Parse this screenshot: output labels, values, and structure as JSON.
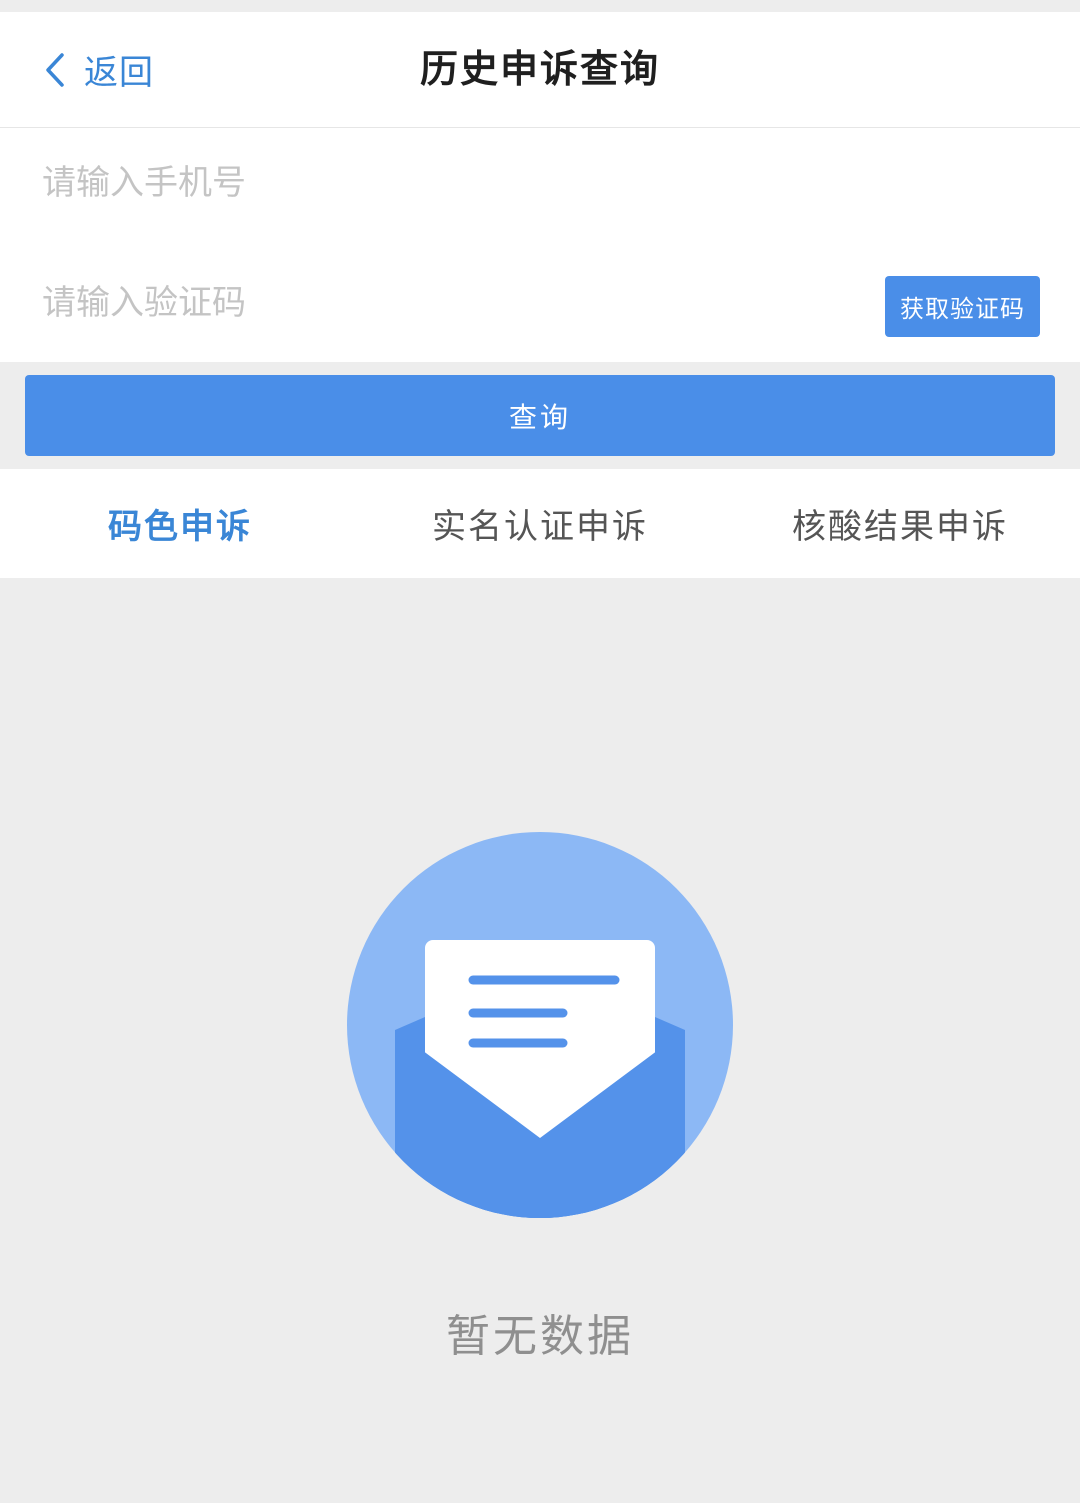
{
  "navbar": {
    "back_label": "返回",
    "title": "历史申诉查询"
  },
  "form": {
    "phone_placeholder": "请输入手机号",
    "code_placeholder": "请输入验证码",
    "get_code_label": "获取验证码",
    "query_label": "查询"
  },
  "tabs": [
    {
      "label": "码色申诉",
      "active": true
    },
    {
      "label": "实名认证申诉",
      "active": false
    },
    {
      "label": "核酸结果申诉",
      "active": false
    }
  ],
  "empty": {
    "icon": "envelope-letter-icon",
    "text": "暂无数据"
  },
  "colors": {
    "accent": "#4a8ee8",
    "link": "#3a86d6",
    "background": "#ededed"
  }
}
